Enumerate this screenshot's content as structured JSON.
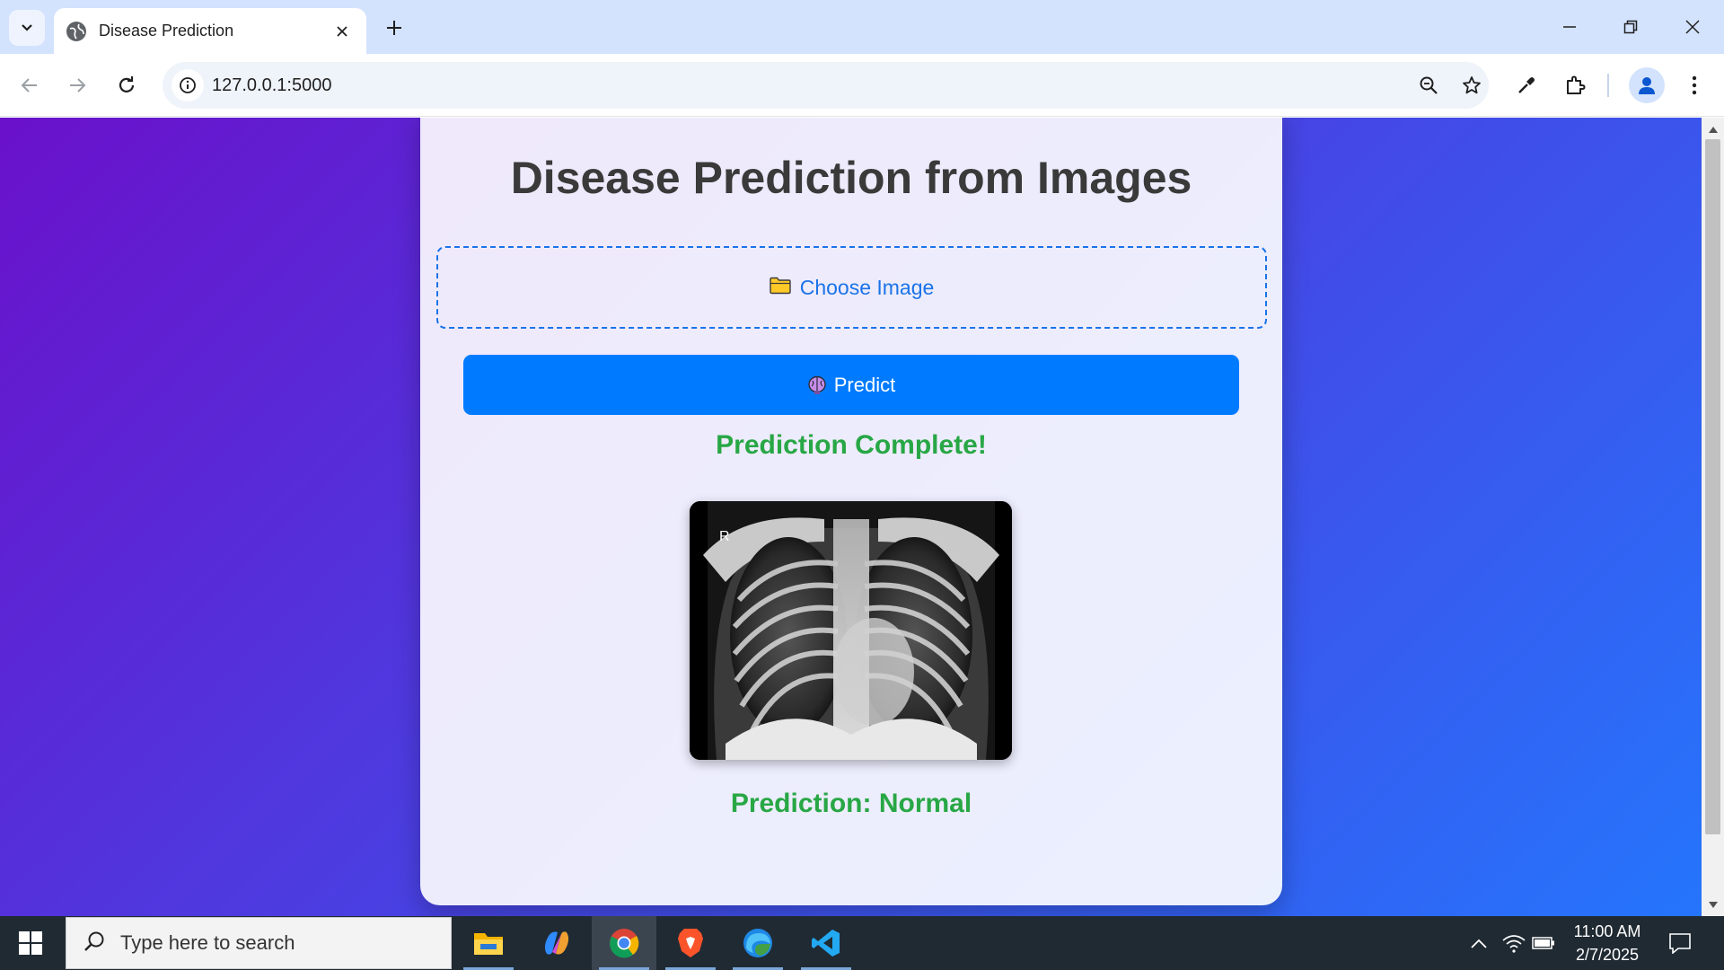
{
  "browser": {
    "tab_title": "Disease Prediction",
    "url": "127.0.0.1:5000"
  },
  "page": {
    "heading": "Disease Prediction from Images",
    "upload_label": "Choose Image",
    "predict_label": "Predict",
    "status_text": "Prediction Complete!",
    "xray_marker": "R",
    "result_text": "Prediction: Normal"
  },
  "taskbar": {
    "search_placeholder": "Type here to search",
    "time": "11:00 AM",
    "date": "2/7/2025"
  },
  "colors": {
    "gradient_start": "#6a11cb",
    "gradient_end": "#2575fc",
    "accent_blue": "#007bff",
    "success_green": "#28a745"
  }
}
